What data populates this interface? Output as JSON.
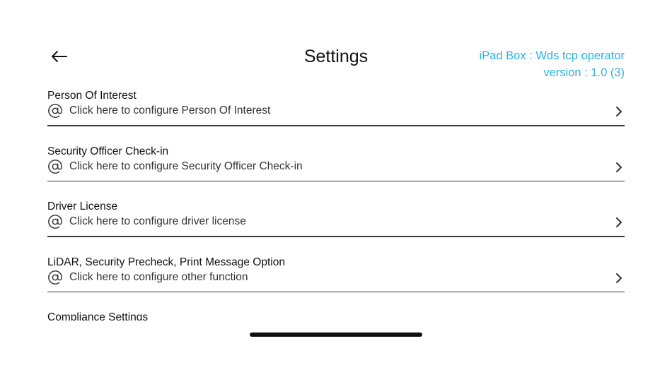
{
  "header": {
    "back_icon": "arrow-left-icon",
    "title": "Settings",
    "app_name": "iPad Box : Wds tcp operator",
    "version": "version : 1.0 (3)",
    "accent_color": "#2bb3e6"
  },
  "settings": {
    "items": [
      {
        "title": "Person Of Interest",
        "subtitle": "Click here to configure Person Of Interest",
        "icon": "at-sign-icon",
        "trailing_icon": "chevron-right-icon"
      },
      {
        "title": "Security Officer Check-in",
        "subtitle": "Click here to configure Security Officer Check-in",
        "icon": "at-sign-icon",
        "trailing_icon": "chevron-right-icon"
      },
      {
        "title": "Driver License",
        "subtitle": "Click here to configure driver license",
        "icon": "at-sign-icon",
        "trailing_icon": "chevron-right-icon"
      },
      {
        "title": "LiDAR, Security Precheck, Print Message Option",
        "subtitle": "Click here to configure other function",
        "icon": "at-sign-icon",
        "trailing_icon": "chevron-right-icon"
      },
      {
        "title": "Compliance Settings"
      }
    ]
  }
}
